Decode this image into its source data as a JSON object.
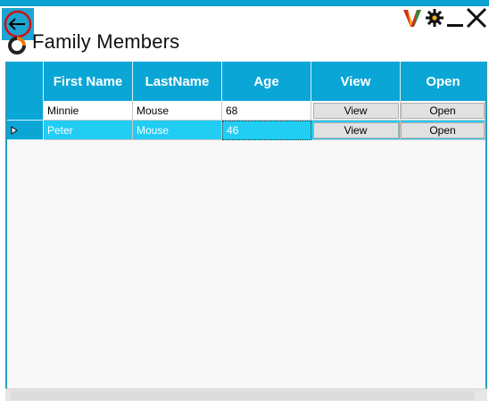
{
  "window": {
    "title": "Family Members"
  },
  "icons": {
    "back": "back-arrow-icon",
    "logo": "brand-logo-icon",
    "tray": [
      "v-logo-icon",
      "gear-icon",
      "minimize-icon",
      "close-icon"
    ]
  },
  "grid": {
    "columns": [
      "First Name",
      "LastName",
      "Age",
      "View",
      "Open"
    ],
    "rows": [
      {
        "first": "Minnie",
        "last": "Mouse",
        "age": "68",
        "view": "View",
        "open": "Open"
      },
      {
        "first": "Peter",
        "last": "Mouse",
        "age": "46",
        "view": "View",
        "open": "Open"
      }
    ]
  },
  "colors": {
    "accent": "#0aa6d6",
    "selected_row": "#22cdf3"
  }
}
